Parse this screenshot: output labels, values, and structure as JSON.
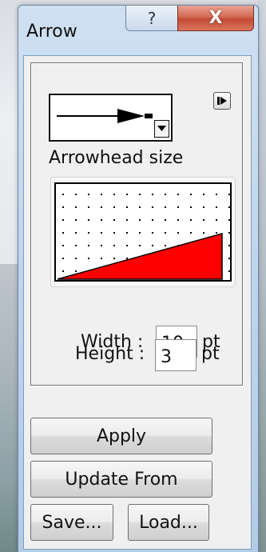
{
  "window": {
    "title": "Arrow",
    "help_label": "?",
    "close_label": "X"
  },
  "arrow_style": {
    "icon": "arrow-right-filled-line",
    "dropdown_icon": "chevron-down-icon",
    "play_icon": "play-next-icon"
  },
  "arrowhead": {
    "label": "Arrowhead size",
    "fill_color": "#ff0000"
  },
  "width": {
    "label": "Width :",
    "value": "10",
    "unit": "pt"
  },
  "height": {
    "label": "Height :",
    "value": "3",
    "unit": "pt"
  },
  "buttons": {
    "apply": "Apply",
    "update_from": "Update From",
    "save": "Save...",
    "load": "Load..."
  }
}
